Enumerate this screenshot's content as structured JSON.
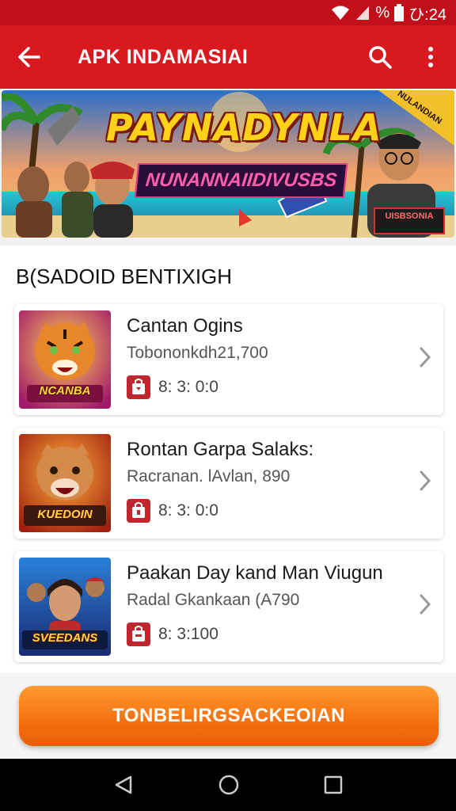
{
  "status": {
    "time": "ひ:24",
    "percent_glyph": "%"
  },
  "app_bar": {
    "title": "APK INDAMASIAI"
  },
  "banner": {
    "title": "PAYNADYNLA",
    "subtitle": "NUNANNAIIDIVUSBS",
    "corner_badge": "NULANDIAN",
    "hero_badge": "UISBSONIA"
  },
  "section": {
    "title": "B(SADOID BENTIXIGH",
    "items": [
      {
        "name": "Cantan Ogins",
        "sub": "Tobononkdh21,700",
        "meta": "8: 3: 0:0",
        "thumb_label": "NCANBA",
        "thumb_icon": "tiger-icon"
      },
      {
        "name": "Rontan Garpa Salaks:",
        "sub": "Racranan. lAvlan, 890",
        "meta": "8: 3: 0:0",
        "thumb_label": "KUEDOIN",
        "thumb_icon": "lion-icon"
      },
      {
        "name": "Paakan Day kand Man Viugun",
        "sub": "Radal Gkankaan (A790",
        "meta": "8: 3:100",
        "thumb_label": "SVEEDANS",
        "thumb_icon": "heroes-icon"
      }
    ]
  },
  "cta": {
    "label": "TONBELIRGSACKEOIAN"
  },
  "colors": {
    "primary": "#d81a20",
    "cta": "#f57010",
    "meta_icon": "#c0262d"
  }
}
